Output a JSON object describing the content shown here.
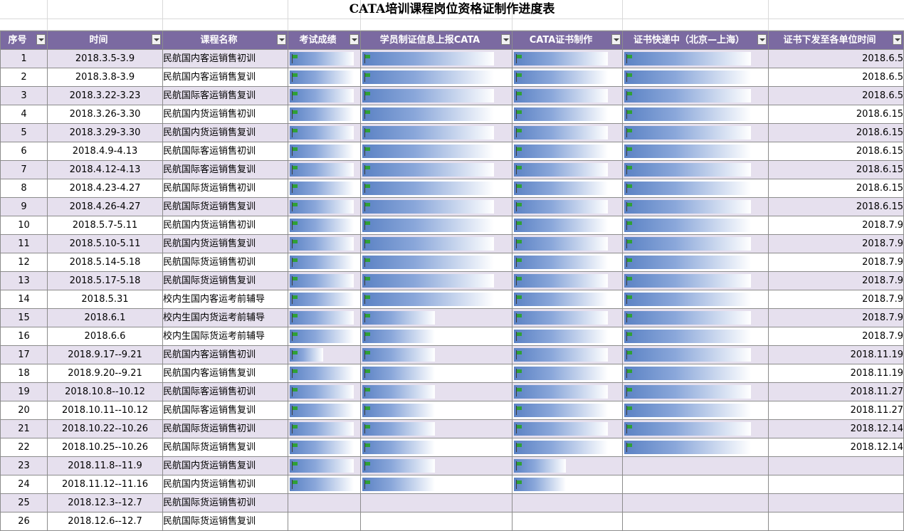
{
  "title": "CATA培训课程岗位资格证制作进度表",
  "icons": {
    "filter_button": "dropdown-arrow-icon",
    "progress_marker": "green-flag-icon"
  },
  "colors": {
    "header_bg": "#7b6aa1",
    "header_text": "#ffffff",
    "band_row": "#e6e0ee",
    "bar": "#5b82c4",
    "flag": "#2fa036"
  },
  "columns": [
    "序号",
    "时间",
    "课程名称",
    "考试成绩",
    "学员制证信息上报CATA",
    "CATA证书制作",
    "证书快递中（北京—上海）",
    "证书下发至各单位时间"
  ],
  "rows": [
    {
      "no": "1",
      "time": "2018.3.5-3.9",
      "course": "民航国内客运销售初训",
      "exam": 0.93,
      "report": 0.89,
      "make": 0.88,
      "ship": 0.89,
      "issue": "2018.6.5"
    },
    {
      "no": "2",
      "time": "2018.3.8-3.9",
      "course": "民航国内客运销售复训",
      "exam": 0.93,
      "report": 0.89,
      "make": 0.88,
      "ship": 0.89,
      "issue": "2018.6.5"
    },
    {
      "no": "3",
      "time": "2018.3.22-3.23",
      "course": "民航国际客运销售复训",
      "exam": 0.93,
      "report": 0.89,
      "make": 0.88,
      "ship": 0.89,
      "issue": "2018.6.5"
    },
    {
      "no": "4",
      "time": "2018.3.26-3.30",
      "course": "民航国内货运销售初训",
      "exam": 0.93,
      "report": 0.89,
      "make": 0.88,
      "ship": 0.89,
      "issue": "2018.6.15"
    },
    {
      "no": "5",
      "time": "2018.3.29-3.30",
      "course": "民航国内货运销售复训",
      "exam": 0.93,
      "report": 0.89,
      "make": 0.88,
      "ship": 0.89,
      "issue": "2018.6.15"
    },
    {
      "no": "6",
      "time": "2018.4.9-4.13",
      "course": "民航国际客运销售初训",
      "exam": 0.93,
      "report": 0.89,
      "make": 0.88,
      "ship": 0.89,
      "issue": "2018.6.15"
    },
    {
      "no": "7",
      "time": "2018.4.12-4.13",
      "course": "民航国际客运销售复训",
      "exam": 0.93,
      "report": 0.89,
      "make": 0.88,
      "ship": 0.89,
      "issue": "2018.6.15"
    },
    {
      "no": "8",
      "time": "2018.4.23-4.27",
      "course": "民航国际货运销售初训",
      "exam": 0.93,
      "report": 0.89,
      "make": 0.88,
      "ship": 0.89,
      "issue": "2018.6.15"
    },
    {
      "no": "9",
      "time": "2018.4.26-4.27",
      "course": "民航国际货运销售复训",
      "exam": 0.93,
      "report": 0.89,
      "make": 0.88,
      "ship": 0.89,
      "issue": "2018.6.15"
    },
    {
      "no": "10",
      "time": "2018.5.7-5.11",
      "course": "民航国内货运销售初训",
      "exam": 0.93,
      "report": 0.89,
      "make": 0.88,
      "ship": 0.89,
      "issue": "2018.7.9"
    },
    {
      "no": "11",
      "time": "2018.5.10-5.11",
      "course": "民航国内货运销售复训",
      "exam": 0.93,
      "report": 0.89,
      "make": 0.88,
      "ship": 0.89,
      "issue": "2018.7.9"
    },
    {
      "no": "12",
      "time": "2018.5.14-5.18",
      "course": "民航国际货运销售初训",
      "exam": 0.93,
      "report": 0.89,
      "make": 0.88,
      "ship": 0.89,
      "issue": "2018.7.9"
    },
    {
      "no": "13",
      "time": "2018.5.17-5.18",
      "course": "民航国际货运销售复训",
      "exam": 0.93,
      "report": 0.89,
      "make": 0.88,
      "ship": 0.89,
      "issue": "2018.7.9"
    },
    {
      "no": "14",
      "time": "2018.5.31",
      "course": "校内生国内客运考前辅导",
      "exam": 0.93,
      "report": 0.89,
      "make": 0.88,
      "ship": 0.89,
      "issue": "2018.7.9"
    },
    {
      "no": "15",
      "time": "2018.6.1",
      "course": "校内生国内货运考前辅导",
      "exam": 0.93,
      "report": 0.5,
      "make": 0.88,
      "ship": 0.89,
      "issue": "2018.7.9"
    },
    {
      "no": "16",
      "time": "2018.6.6",
      "course": "校内生国际货运考前辅导",
      "exam": 0.93,
      "report": 0.5,
      "make": 0.88,
      "ship": 0.89,
      "issue": "2018.7.9"
    },
    {
      "no": "17",
      "time": "2018.9.17--9.21",
      "course": "民航国内客运销售初训",
      "exam": 0.5,
      "report": 0.5,
      "make": 0.88,
      "ship": 0.89,
      "issue": "2018.11.19"
    },
    {
      "no": "18",
      "time": "2018.9.20--9.21",
      "course": "民航国内客运销售复训",
      "exam": 0.93,
      "report": 0.5,
      "make": 0.88,
      "ship": 0.89,
      "issue": "2018.11.19"
    },
    {
      "no": "19",
      "time": "2018.10.8--10.12",
      "course": "民航国际客运销售初训",
      "exam": 0.93,
      "report": 0.5,
      "make": 0.88,
      "ship": 0.89,
      "issue": "2018.11.27"
    },
    {
      "no": "20",
      "time": "2018.10.11--10.12",
      "course": "民航国际客运销售复训",
      "exam": 0.93,
      "report": 0.5,
      "make": 0.88,
      "ship": 0.89,
      "issue": "2018.11.27"
    },
    {
      "no": "21",
      "time": "2018.10.22--10.26",
      "course": "民航国际货运销售初训",
      "exam": 0.93,
      "report": 0.5,
      "make": 0.88,
      "ship": 0.89,
      "issue": "2018.12.14"
    },
    {
      "no": "22",
      "time": "2018.10.25--10.26",
      "course": "民航国际货运销售复训",
      "exam": 0.93,
      "report": 0.5,
      "make": 0.88,
      "ship": 0.89,
      "issue": "2018.12.14"
    },
    {
      "no": "23",
      "time": "2018.11.8--11.9",
      "course": "民航国内货运销售复训",
      "exam": 0.93,
      "report": 0.5,
      "make": 0.5,
      "ship": 0,
      "issue": ""
    },
    {
      "no": "24",
      "time": "2018.11.12--11.16",
      "course": "民航国内货运销售初训",
      "exam": 0.93,
      "report": 0.5,
      "make": 0.5,
      "ship": 0,
      "issue": ""
    },
    {
      "no": "25",
      "time": "2018.12.3--12.7",
      "course": "民航国际货运销售初训",
      "exam": 0,
      "report": 0,
      "make": 0,
      "ship": 0,
      "issue": ""
    },
    {
      "no": "26",
      "time": "2018.12.6--12.7",
      "course": "民航国际货运销售复训",
      "exam": 0,
      "report": 0,
      "make": 0,
      "ship": 0,
      "issue": ""
    }
  ]
}
